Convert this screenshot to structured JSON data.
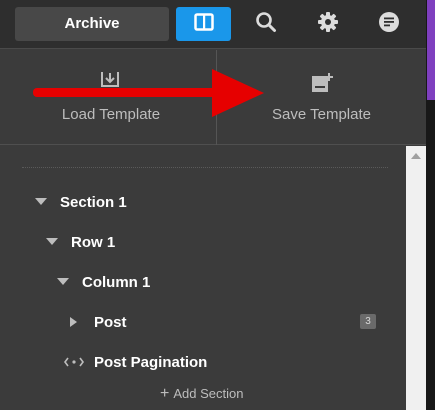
{
  "toolbar": {
    "archive_label": "Archive",
    "icons": [
      "columns-icon",
      "search-icon",
      "gear-icon",
      "notes-icon"
    ],
    "accent_color": "#1a97ea"
  },
  "templates": {
    "load_label": "Load Template",
    "save_label": "Save Template"
  },
  "tree": {
    "section_label": "Section 1",
    "row_label": "Row 1",
    "column_label": "Column 1",
    "post_label": "Post",
    "post_badge": "3",
    "pagination_label": "Post Pagination",
    "add_section_label": "Add Section"
  },
  "annotation": {
    "arrow_color": "#e60000"
  }
}
